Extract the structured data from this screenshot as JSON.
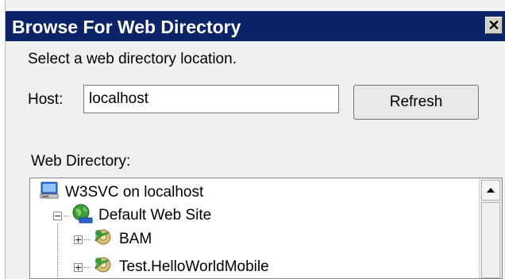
{
  "dialog": {
    "title": "Browse For Web Directory",
    "close_glyph": "✕",
    "instruction": "Select a web directory location.",
    "host_label": "Host:",
    "host_value": "localhost",
    "refresh_label": "Refresh",
    "webdir_label": "Web Directory:"
  },
  "tree": {
    "items": [
      {
        "label": "W3SVC on localhost",
        "icon": "server-computer-icon",
        "expander": ""
      },
      {
        "label": "Default Web Site",
        "icon": "globe-site-icon",
        "expander": "−"
      },
      {
        "label": "BAM",
        "icon": "gear-globe-icon",
        "expander": "+"
      },
      {
        "label": "Test.HelloWorldMobile",
        "icon": "gear-globe-icon",
        "expander": "+"
      }
    ]
  },
  "scrollbar": {
    "up_arrow_icon": "scroll-up-arrow-icon"
  },
  "colors": {
    "titlebar": "#0b2468",
    "dialog_bg": "#f0f0f0"
  }
}
